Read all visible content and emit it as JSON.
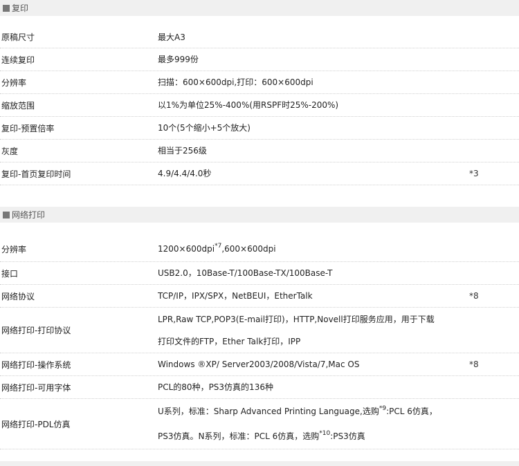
{
  "copy": {
    "header": "复印",
    "rows": [
      {
        "label": "原稿尺寸",
        "value": "最大A3",
        "note": ""
      },
      {
        "label": "连续复印",
        "value": "最多999份",
        "note": ""
      },
      {
        "label": "分辨率",
        "value": "扫描：600×600dpi,打印：600×600dpi",
        "note": ""
      },
      {
        "label": "缩放范围",
        "value": "以1%为单位25%-400%(用RSPF时25%-200%)",
        "note": ""
      },
      {
        "label": "复印-预置倍率",
        "value": "10个(5个缩小+5个放大)",
        "note": ""
      },
      {
        "label": "灰度",
        "value": "相当于256级",
        "note": ""
      },
      {
        "label": "复印-首页复印时间",
        "value": "4.9/4.4/4.0秒",
        "note": "*3"
      }
    ]
  },
  "network": {
    "header": "网络打印",
    "resolution": {
      "label": "分辨率",
      "value_a": "1200×600dpi",
      "sup": "*7",
      "value_b": ",600×600dpi"
    },
    "interface": {
      "label": "接口",
      "value": "USB2.0，10Base-T/100Base-TX/100Base-T"
    },
    "protocols": {
      "label": "网络协议",
      "value": "TCP/IP，IPX/SPX，NetBEUI，EtherTalk",
      "note": "*8"
    },
    "print_protocols": {
      "label": "网络打印-打印协议",
      "line1": "LPR,Raw TCP,POP3(E-mail打印)，HTTP,Novell打印服务应用，用于下载",
      "line2": "打印文件的FTP，Ether Talk打印，IPP"
    },
    "os": {
      "label": "网络打印-操作系统",
      "value": "Windows ®XP/ Server2003/2008/Vista/7,Mac OS",
      "note": "*8"
    },
    "fonts": {
      "label": "网络打印-可用字体",
      "value": "PCL的80种，PS3仿真的136种"
    },
    "pdl": {
      "label": "网络打印-PDL仿真",
      "line1a": "U系列，标准：Sharp Advanced Printing Language,选购",
      "sup1": "*9",
      "line1b": ":PCL 6仿真，",
      "line2a": "PS3仿真。N系列，标准：PCL 6仿真，选购",
      "sup2": "*10",
      "line2b": ":PS3仿真"
    }
  }
}
